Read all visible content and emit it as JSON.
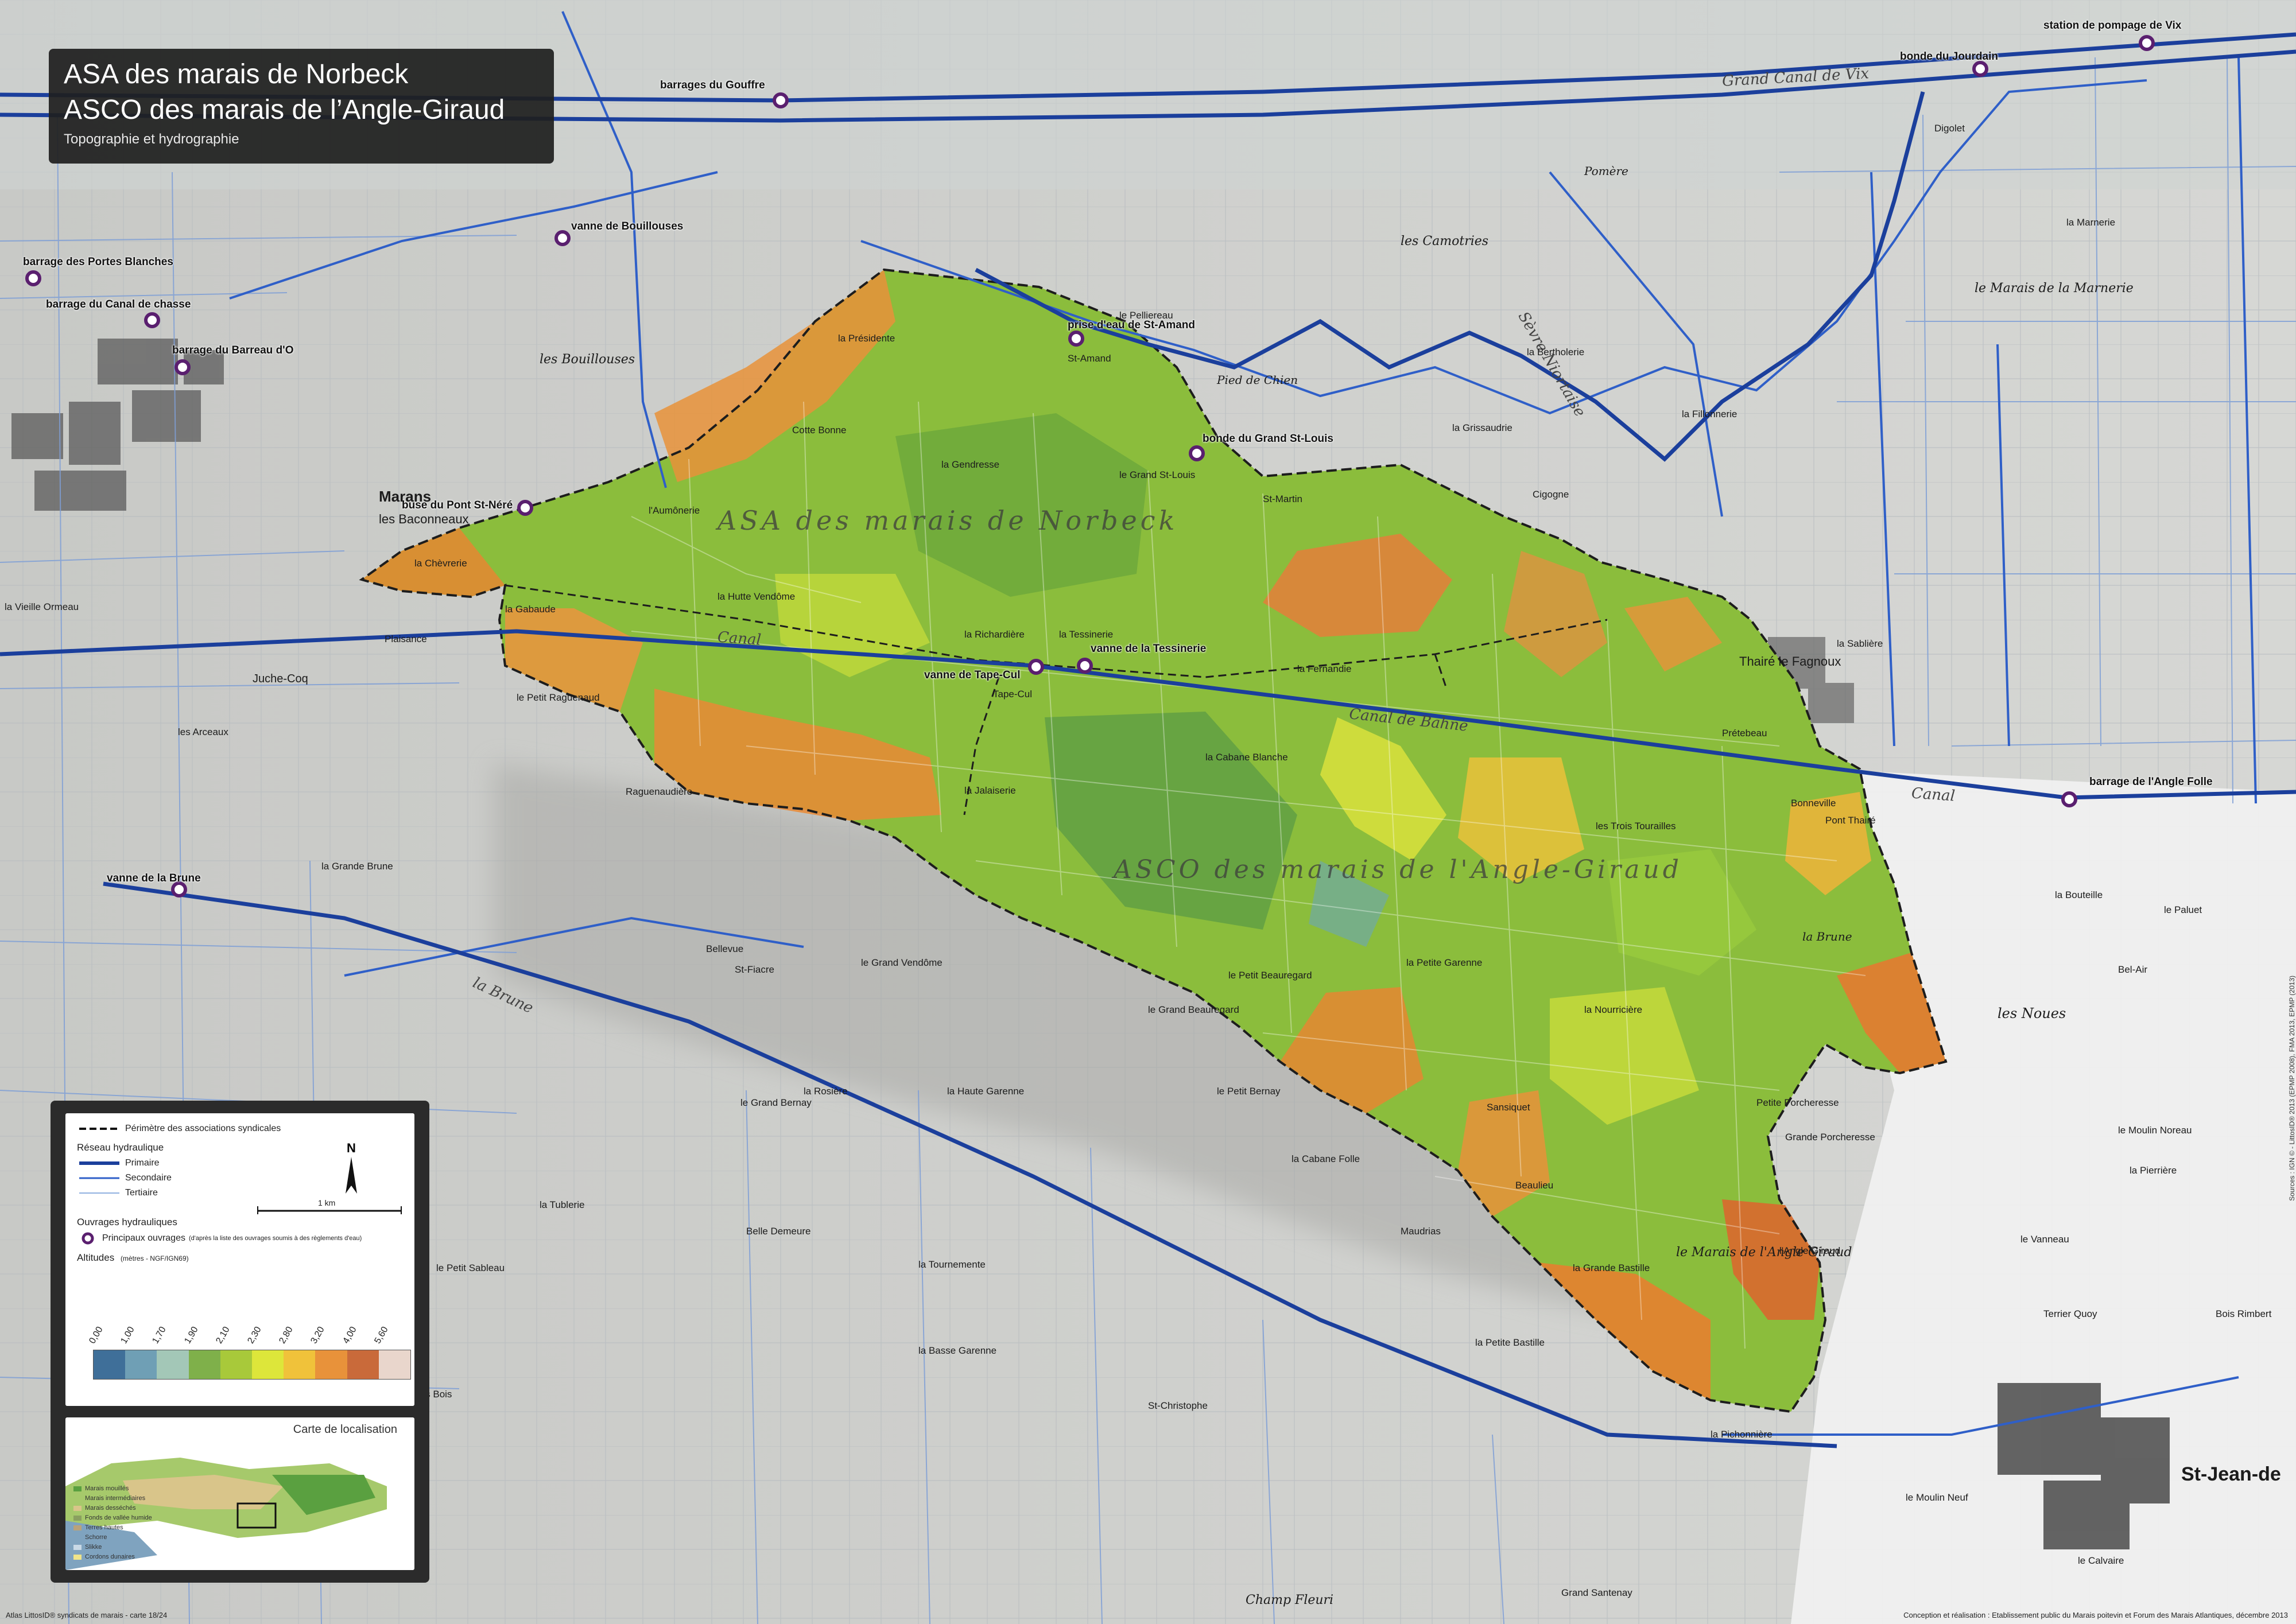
{
  "title": {
    "line1": "ASA des marais de Norbeck",
    "line2": "ASCO des marais de l’Angle-Giraud",
    "subtitle": "Topographie et hydrographie"
  },
  "zones": {
    "norbeck": "ASA des marais de Norbeck",
    "angle_giraud": "ASCO des marais de l'Angle-Giraud"
  },
  "ouvrages": [
    "barrages du Gouffre",
    "station de pompage de Vix",
    "bonde du Jourdain",
    "vanne de Bouillouses",
    "barrage des Portes Blanches",
    "barrage du Canal de chasse",
    "barrage du Barreau d'O",
    "prise d'eau de St-Amand",
    "bonde du Grand St-Louis",
    "buse du Pont St-Néré",
    "vanne de la Tessinerie",
    "vanne de Tape-Cul",
    "barrage de l'Angle Folle",
    "vanne de la Brune"
  ],
  "places": [
    "Marans",
    "les Baconneaux",
    "la Chèvrerie",
    "l'Aumônerie",
    "la Hutte Vendôme",
    "la Richardière",
    "la Tessinerie",
    "la Fernandie",
    "Tape-Cul",
    "la Cabane Blanche",
    "la Jalaiserie",
    "les Trois Tourailles",
    "la Petite Garenne",
    "la Nourricière",
    "Sansiquet",
    "Beaulieu",
    "la Grande Bastille",
    "la Pichonnière",
    "Thairé le Fagnoux",
    "Prétebeau",
    "Bonneville",
    "Pont Thairé",
    "la Bouteille",
    "les Noues",
    "l'Angle Giraud",
    "St-Jean-de",
    "le Vanneau",
    "St-Christophe",
    "Bellevue",
    "St-Fiacre",
    "le Grand Vendôme",
    "Juche-Coq",
    "la Gabaude",
    "Cotte Bonne",
    "la Présidente",
    "St-Amand",
    "St-Martin",
    "Cigogne",
    "la Gendresse",
    "le Grand St-Louis",
    "les Bouillouses",
    "les Camotries",
    "la Marnerie",
    "le Marais de la Marnerie",
    "la Sablière",
    "Digolet",
    "le Pelliereau",
    "Pied de Chien",
    "Pomère",
    "la Bertholerie",
    "la Grissaudrie",
    "la Fillonnerie",
    "le Marais de l'Angle Giraud",
    "Grande Porcheresse",
    "Petite Porcheresse",
    "la Brune",
    "la Grande Brune",
    "Belle Demeure",
    "la Tournemente",
    "la Basse Garenne",
    "Champ Fleuri",
    "Grand Santenay",
    "le Moulin Neuf",
    "le Calvaire",
    "le Paluet",
    "Bel-Air",
    "le Moulin Noreau",
    "la Pierrière",
    "Terrier Quoy",
    "Bois Rimbert",
    "le Grand Bernay",
    "la Rosière",
    "la Haute Garenne",
    "le Petit Bernay",
    "la Cabane Folle",
    "Maudrias",
    "la Petite Bastille",
    "le Petit Beauregard",
    "le Grand Beauregard",
    "la Tublerie",
    "le Petit Sableau",
    "la Cabane des Bois",
    "Raguenaudière",
    "le Petit Raguenaud",
    "la Vieille Ormeau",
    "Plaisance",
    "les Arceaux"
  ],
  "canals": [
    "Canal",
    "Grand Canal de Vix",
    "Sèvre Niortaise",
    "la Brune",
    "Canal de Bahne",
    "Canal"
  ],
  "legend": {
    "perimeter": "Périmètre des associations syndicales",
    "network_head": "Réseau hydraulique",
    "primary": "Primaire",
    "secondary": "Secondaire",
    "tertiary": "Tertiaire",
    "scale": "1 km",
    "ouvrages_head": "Ouvrages hydrauliques",
    "principal": "Principaux ouvrages",
    "principal_note": "(d'après la liste des ouvrages soumis à des règlements d'eau)",
    "alt_head": "Altitudes",
    "alt_unit": "(mètres - NGF/IGN69)",
    "alt_ticks": [
      "0,00",
      "1,00",
      "1,70",
      "1,90",
      "2,10",
      "2,30",
      "2,80",
      "3,20",
      "4,00",
      "5,60"
    ],
    "alt_colors": [
      "#3f6f99",
      "#6f9fb5",
      "#a3c7b7",
      "#7fb04a",
      "#a8c93a",
      "#dde63a",
      "#f0c23a",
      "#e8923a",
      "#c96a3a",
      "#e9d6cc"
    ],
    "north": "N"
  },
  "location_map": {
    "title": "Carte de localisation",
    "items": [
      {
        "label": "Marais mouillés",
        "color": "#5aa040"
      },
      {
        "label": "Marais intermédiaires",
        "color": "#a6c96b"
      },
      {
        "label": "Marais desséchés",
        "color": "#d9c58a"
      },
      {
        "label": "Fonds de vallée humide",
        "color": "#8aa060"
      },
      {
        "label": "Terres hautes",
        "color": "#b9a27a"
      },
      {
        "label": "Schorre",
        "color": "#7fa3bf"
      },
      {
        "label": "Slikke",
        "color": "#c9d9e6"
      },
      {
        "label": "Cordons dunaires",
        "color": "#efe48a"
      }
    ]
  },
  "footer": {
    "left": "Atlas LittosID® syndicats de marais - carte 18/24",
    "right": "Conception et réalisation : Etablissement public du Marais poitevin et Forum des Marais Atlantiques, décembre 2013",
    "vertical": "Sources : IGN ©  - LittosID® 2013 (EPMP 2008), FMA 2013, EPMP (2013)"
  },
  "colors": {
    "primary": "#1b3f9c",
    "secondary": "#2f5fc8",
    "tertiary": "#8fb0e0",
    "marker": "#5a1f6f"
  }
}
